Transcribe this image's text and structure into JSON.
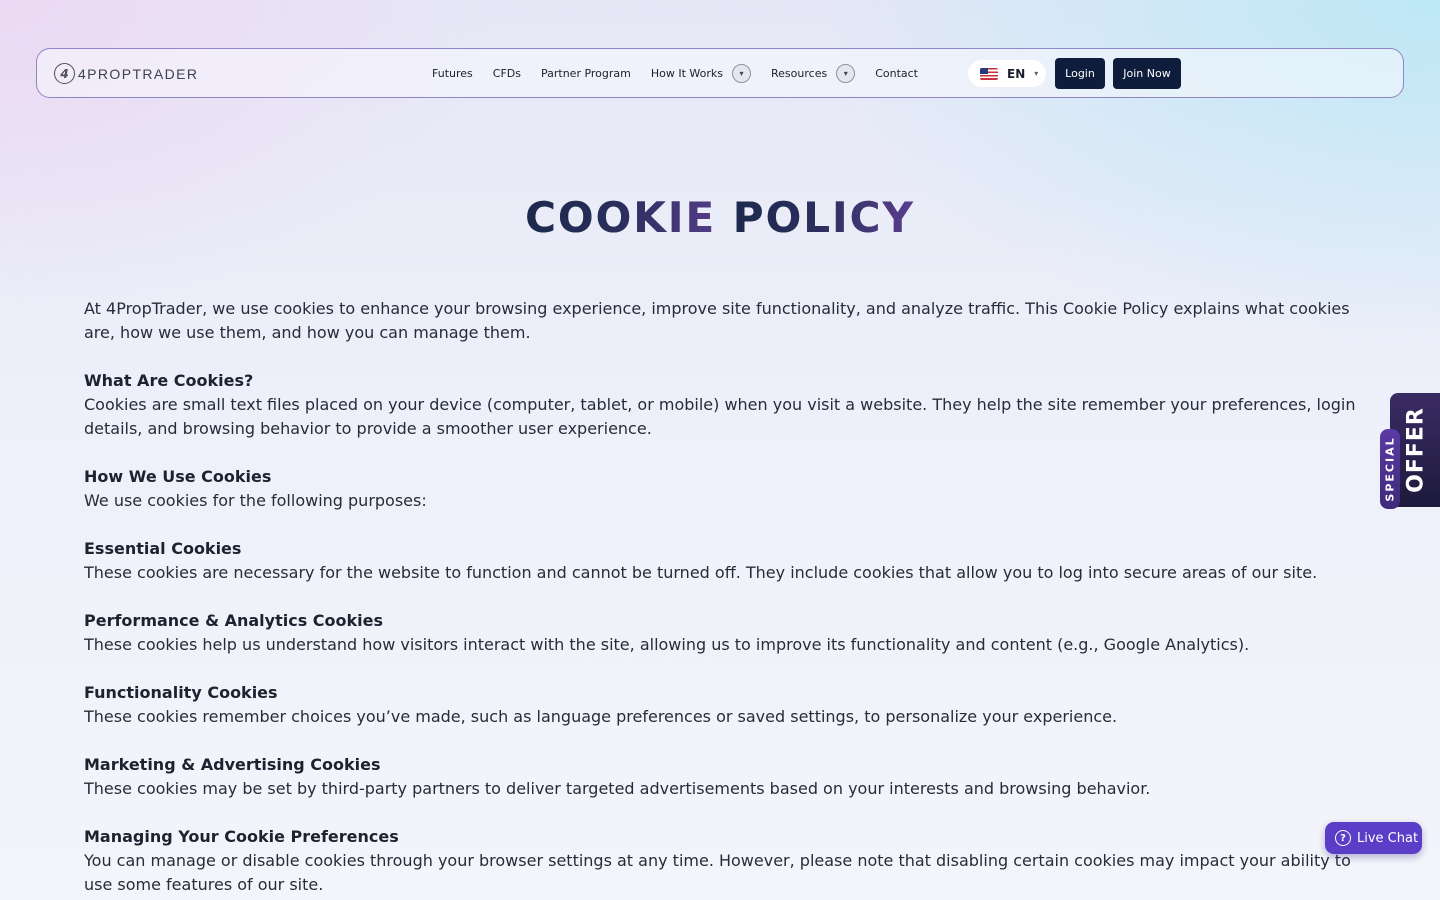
{
  "header": {
    "logo_mark": "4",
    "logo_text": "4PROPTRADER",
    "nav": [
      {
        "label": "Futures"
      },
      {
        "label": "CFDs"
      },
      {
        "label": "Partner Program"
      },
      {
        "label": "How It Works",
        "caret": "▾"
      },
      {
        "label": "Resources",
        "caret": "▾"
      },
      {
        "label": "Contact"
      }
    ],
    "language": {
      "code": "EN",
      "caret": "▾"
    },
    "login_label": "Login",
    "join_label": "Join Now"
  },
  "page": {
    "title_part1": "COOKIE ",
    "title_part2": "POLICY",
    "intro": "At 4PropTrader, we use cookies to enhance your browsing experience, improve site functionality, and analyze traffic. This Cookie Policy explains what cookies are, how we use them, and how you can manage them.",
    "sections": [
      {
        "heading": "What Are Cookies?",
        "body": "Cookies are small text files placed on your device (computer, tablet, or mobile) when you visit a website. They help the site remember your preferences, login details, and browsing behavior to provide a smoother user experience."
      },
      {
        "heading": "How We Use Cookies",
        "body": "We use cookies for the following purposes:"
      },
      {
        "heading": "Essential Cookies",
        "body": "These cookies are necessary for the website to function and cannot be turned off. They include cookies that allow you to log into secure areas of our site."
      },
      {
        "heading": "Performance & Analytics Cookies",
        "body": "These cookies help us understand how visitors interact with the site, allowing us to improve its functionality and content (e.g., Google Analytics)."
      },
      {
        "heading": "Functionality Cookies",
        "body": "These cookies remember choices you’ve made, such as language preferences or saved settings, to personalize your experience."
      },
      {
        "heading": "Marketing & Advertising Cookies",
        "body": "These cookies may be set by third-party partners to deliver targeted advertisements based on your interests and browsing behavior."
      },
      {
        "heading": "Managing Your Cookie Preferences",
        "body": "You can manage or disable cookies through your browser settings at any time. However, please note that disabling certain cookies may impact your ability to use some features of our site."
      }
    ]
  },
  "offer": {
    "special": "SPECIAL",
    "offer": "OFFER"
  },
  "live_chat": {
    "icon": "?",
    "label": "Live Chat"
  },
  "colors": {
    "primary_dark": "#0e1d3b",
    "accent_purple": "#5a3ec8",
    "nav_border": "#8f86c9"
  }
}
